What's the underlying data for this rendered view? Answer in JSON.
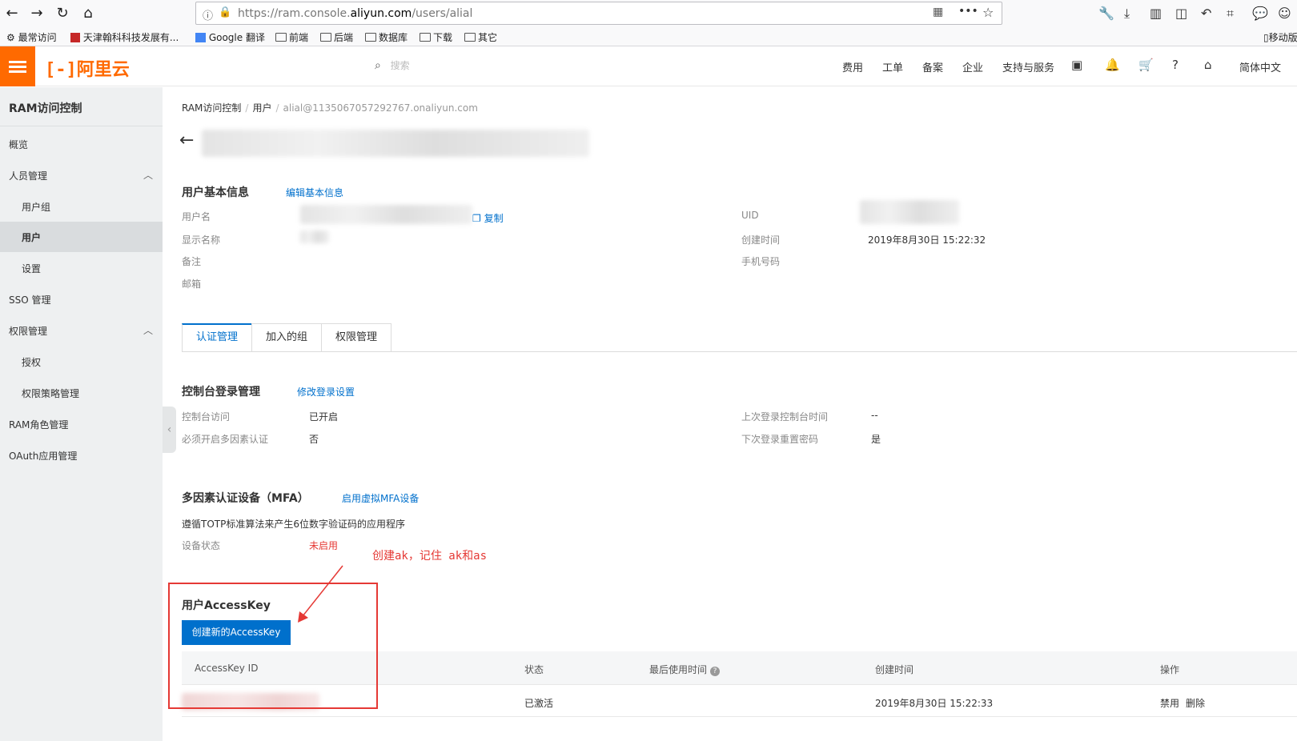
{
  "browser": {
    "url_prefix": "https://ram.console.",
    "url_domain": "aliyun.com",
    "url_path": "/users/alial",
    "bookmarks": [
      {
        "label": "最常访问",
        "icon": "gear-icon"
      },
      {
        "label": "天津翰科科技发展有...",
        "icon": "site-icon"
      },
      {
        "label": "Google 翻译",
        "icon": "translate-icon"
      },
      {
        "label": "前端",
        "icon": "folder-icon"
      },
      {
        "label": "后端",
        "icon": "folder-icon"
      },
      {
        "label": "数据库",
        "icon": "folder-icon"
      },
      {
        "label": "下载",
        "icon": "folder-icon"
      },
      {
        "label": "其它",
        "icon": "folder-icon"
      }
    ],
    "mobile_bookmark": "移动版"
  },
  "topbar": {
    "brand": "阿里云",
    "search_placeholder": "搜索",
    "links": [
      "费用",
      "工单",
      "备案",
      "企业",
      "支持与服务"
    ],
    "language": "简体中文"
  },
  "sidebar": {
    "title": "RAM访问控制",
    "items": [
      {
        "label": "概览",
        "level": 1
      },
      {
        "label": "人员管理",
        "level": 1,
        "expanded": true
      },
      {
        "label": "用户组",
        "level": 2
      },
      {
        "label": "用户",
        "level": 2,
        "active": true
      },
      {
        "label": "设置",
        "level": 2
      },
      {
        "label": "SSO 管理",
        "level": 1
      },
      {
        "label": "权限管理",
        "level": 1,
        "expanded": true
      },
      {
        "label": "授权",
        "level": 2
      },
      {
        "label": "权限策略管理",
        "level": 2
      },
      {
        "label": "RAM角色管理",
        "level": 1
      },
      {
        "label": "OAuth应用管理",
        "level": 1
      }
    ]
  },
  "breadcrumb": {
    "items": [
      "RAM访问控制",
      "用户",
      "alial@1135067057292767.onaliyun.com"
    ]
  },
  "basic_info": {
    "title": "用户基本信息",
    "edit_link": "编辑基本信息",
    "copy_link": "复制",
    "labels": {
      "username": "用户名",
      "display_name": "显示名称",
      "note": "备注",
      "email": "邮箱",
      "uid": "UID",
      "created": "创建时间",
      "phone": "手机号码"
    },
    "created_value": "2019年8月30日 15:22:32"
  },
  "tabs": [
    "认证管理",
    "加入的组",
    "权限管理"
  ],
  "console_login": {
    "title": "控制台登录管理",
    "edit_link": "修改登录设置",
    "rows": [
      {
        "label": "控制台访问",
        "value": "已开启"
      },
      {
        "label": "必须开启多因素认证",
        "value": "否"
      }
    ],
    "right_rows": [
      {
        "label": "上次登录控制台时间",
        "value": "--"
      },
      {
        "label": "下次登录重置密码",
        "value": "是"
      }
    ]
  },
  "mfa": {
    "title": "多因素认证设备（MFA）",
    "link": "启用虚拟MFA设备",
    "desc": "遵循TOTP标准算法来产生6位数字验证码的应用程序",
    "status_label": "设备状态",
    "status_value": "未启用"
  },
  "accesskey": {
    "title": "用户AccessKey",
    "create_button": "创建新的AccessKey",
    "columns": [
      "AccessKey ID",
      "状态",
      "最后使用时间",
      "创建时间",
      "操作"
    ],
    "row": {
      "status": "已激活",
      "created": "2019年8月30日 15:22:33",
      "actions": [
        "禁用",
        "删除"
      ]
    }
  },
  "annotation": {
    "text": "创建ak，记住 ak和as",
    "color": "#e53935"
  },
  "colors": {
    "brand": "#ff6a00",
    "link": "#0070cc",
    "danger": "#e53935"
  }
}
